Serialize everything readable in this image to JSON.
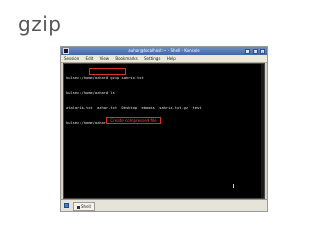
{
  "slide": {
    "title": "gzip"
  },
  "window": {
    "title": "auhar@localhost:~ - Shell - Konsole",
    "controls": [
      "minimize",
      "maximize",
      "close"
    ],
    "menu": [
      "Session",
      "Edit",
      "View",
      "Bookmarks",
      "Settings",
      "Help"
    ]
  },
  "terminal": {
    "lines": [
      "kulsec:/home/azhar# gzip sahrix.txt",
      "kulsec:/home/azhar# ls",
      "atalarik.txt  azhar.txt  Desktop  ebooks  sahrix.txt.gz  test",
      "kulsec:/home/azhar#"
    ],
    "callout": "Create compressed file"
  },
  "taskbar": {
    "item": "Shell"
  }
}
